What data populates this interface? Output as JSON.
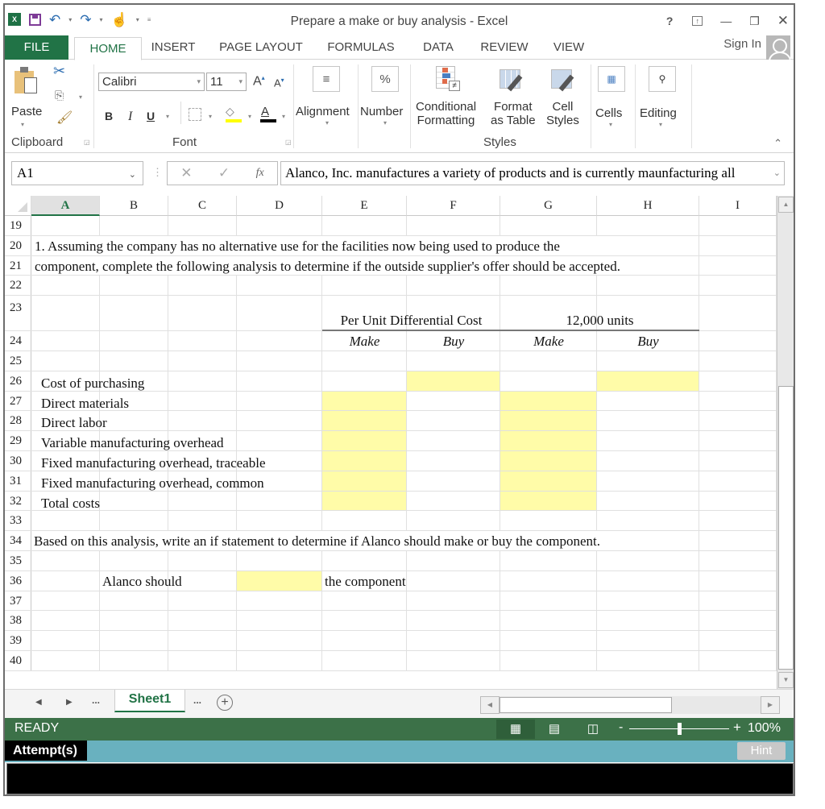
{
  "window": {
    "title": "Prepare a make or buy analysis - Excel",
    "controls": [
      "?",
      "restore-ribbon",
      "minimize",
      "restore",
      "close"
    ]
  },
  "qat": {
    "app_icon": "excel-icon",
    "items": [
      "save-icon",
      "undo-icon",
      "redo-icon",
      "touch-mode-icon",
      "customize-icon"
    ]
  },
  "ribbon_tabs": [
    {
      "label": "FILE",
      "active": false
    },
    {
      "label": "HOME",
      "active": true
    },
    {
      "label": "INSERT",
      "active": false
    },
    {
      "label": "PAGE LAYOUT",
      "active": false
    },
    {
      "label": "FORMULAS",
      "active": false
    },
    {
      "label": "DATA",
      "active": false
    },
    {
      "label": "REVIEW",
      "active": false
    },
    {
      "label": "VIEW",
      "active": false
    }
  ],
  "account": {
    "sign_in_label": "Sign In"
  },
  "ribbon": {
    "clipboard": {
      "label": "Clipboard",
      "paste_label": "Paste"
    },
    "font": {
      "label": "Font",
      "font_name": "Calibri",
      "font_size": "11",
      "bold": "B",
      "italic": "I",
      "underline": "U",
      "fill_color": "#ffff00",
      "font_color": "#000000"
    },
    "alignment": {
      "label": "Alignment"
    },
    "number": {
      "label": "Number",
      "glyph": "%"
    },
    "styles": {
      "label": "Styles",
      "conditional_formatting": [
        "Conditional",
        "Formatting"
      ],
      "format_as_table": [
        "Format",
        "as Table"
      ],
      "cell_styles": [
        "Cell",
        "Styles"
      ]
    },
    "cells": {
      "label": "Cells"
    },
    "editing": {
      "label": "Editing"
    }
  },
  "formula_bar": {
    "name_box": "A1",
    "cancel_glyph": "✕",
    "enter_glyph": "✓",
    "fx_label": "fx",
    "content": "Alanco, Inc. manufactures a variety of products and is currently maunfacturing all"
  },
  "columns": [
    "A",
    "B",
    "C",
    "D",
    "E",
    "F",
    "G",
    "H",
    "I"
  ],
  "selected_column": "A",
  "rows": [
    "19",
    "20",
    "21",
    "22",
    "23",
    "24",
    "25",
    "26",
    "27",
    "28",
    "29",
    "30",
    "31",
    "32",
    "33",
    "34",
    "35",
    "36",
    "37",
    "38",
    "39",
    "40"
  ],
  "sheet": {
    "r20": "1. Assuming the company has no alternative use for the facilities now being used to produce the",
    "r21": "component, complete the following analysis to determine if the outside supplier's offer should be accepted.",
    "r23_e": "Per Unit Differential Cost",
    "r23_g": "12,000 units",
    "r24_e": "Make",
    "r24_f": "Buy",
    "r24_g": "Make",
    "r24_h": "Buy",
    "r26": "Cost of purchasing",
    "r27": "Direct materials",
    "r28": "Direct labor",
    "r29": "Variable manufacturing overhead",
    "r30": "Fixed manufacturing overhead, traceable",
    "r31": "Fixed manufacturing overhead, common",
    "r32": "Total costs",
    "r34": "Based on this analysis, write an if statement to determine if Alanco should make or buy the component.",
    "r36_b": "Alanco should",
    "r36_e": "the component",
    "input_color": "#fffca8"
  },
  "sheet_tabs": {
    "prev": "◀",
    "next": "▶",
    "more_left": "...",
    "active": "Sheet1",
    "more_right": "...",
    "add": "+"
  },
  "status_bar": {
    "mode": "READY",
    "views": [
      "normal-view",
      "page-layout-view",
      "page-break-view"
    ],
    "zoom_minus": "-",
    "zoom_plus": "+",
    "zoom_level": "100%",
    "zoom_fraction": 0.5
  },
  "attempt_bar": {
    "label": "Attempt(s)",
    "hint_label": "Hint"
  },
  "colors": {
    "excel_green": "#217346",
    "status_green": "#3c7148",
    "attempt_teal": "#69b1bf"
  }
}
